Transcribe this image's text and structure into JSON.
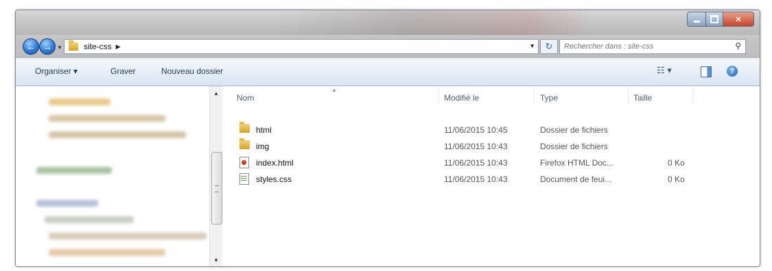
{
  "window": {
    "title_bar": ""
  },
  "address": {
    "breadcrumb": [
      "site-css"
    ],
    "search_placeholder": "Rechercher dans : site-css"
  },
  "toolbar": {
    "organize_label": "Organiser ▾",
    "burn_label": "Graver",
    "new_folder_label": "Nouveau dossier",
    "views_label": "☷ ▾"
  },
  "columns": {
    "name": "Nom",
    "modified": "Modifié le",
    "type": "Type",
    "size": "Taille"
  },
  "files": [
    {
      "name": "html",
      "modified": "11/06/2015 10:45",
      "type": "Dossier de fichiers",
      "size": "",
      "icon": "folder-icon"
    },
    {
      "name": "img",
      "modified": "11/06/2015 10:43",
      "type": "Dossier de fichiers",
      "size": "",
      "icon": "folder-icon"
    },
    {
      "name": "index.html",
      "modified": "11/06/2015 10:43",
      "type": "Firefox HTML Doc...",
      "size": "0 Ko",
      "icon": "html-file-icon"
    },
    {
      "name": "styles.css",
      "modified": "11/06/2015 10:43",
      "type": "Document de feui...",
      "size": "0 Ko",
      "icon": "css-file-icon"
    }
  ],
  "colors": {
    "toolbar_text": "#1e395b",
    "header_text": "#4c607a",
    "close_button": "#c8442c",
    "nav_button": "#2f7bd6"
  }
}
